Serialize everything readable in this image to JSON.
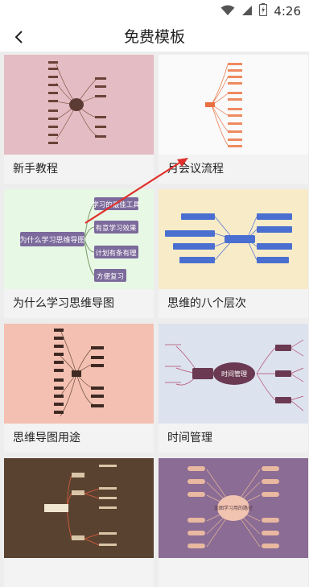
{
  "status_bar": {
    "time": "4:26"
  },
  "header": {
    "title": "免费模板"
  },
  "cards": [
    {
      "label": "新手教程",
      "theme": "#e4bcc3"
    },
    {
      "label": "月会议流程",
      "theme": "#fafafa"
    },
    {
      "label": "为什么学习思维导图",
      "theme": "#e7f8e4",
      "center": "为什么学习思维导图",
      "branches": [
        "学习的最佳工具",
        "有意学习效果",
        "计划有条有理",
        "方便复习"
      ]
    },
    {
      "label": "思维的八个层次",
      "theme": "#f8ebc8"
    },
    {
      "label": "思维导图用途",
      "theme": "#f3c0b2"
    },
    {
      "label": "时间管理",
      "theme": "#dde2ef",
      "center": "时间管理"
    },
    {
      "label": "",
      "theme": "#5a4230"
    },
    {
      "label": "",
      "theme": "#8b6c94",
      "center": "蓝图学习用的路径"
    }
  ]
}
